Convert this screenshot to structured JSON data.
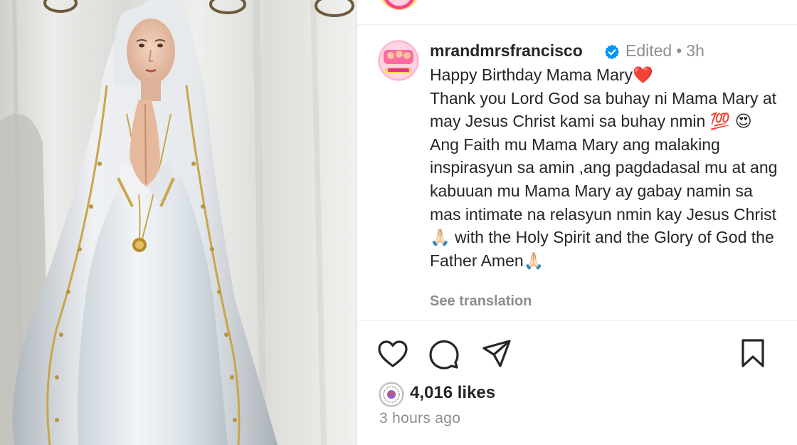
{
  "post": {
    "username": "mrandmrsfrancisco",
    "edited_label": "Edited",
    "separator": "•",
    "age": "3h",
    "caption": "Happy Birthday Mama Mary❤️\nThank you Lord God sa buhay ni Mama Mary at may  Jesus Christ kami sa buhay nmin 💯 😍 Ang Faith mu Mama Mary ang malaking inspirasyun sa amin ,ang pagdadasal mu at ang kabuuan mu Mama Mary ay gabay namin sa mas intimate na relasyun nmin kay Jesus Christ🙏🏻 with the Holy Spirit and the Glory of God the Father Amen🙏🏻",
    "see_translation": "See translation",
    "likes_text": "4,016 likes",
    "timestamp": "3 hours ago"
  },
  "icons": {
    "verified": "verified-badge-icon",
    "like": "heart-icon",
    "comment": "comment-bubble-icon",
    "share": "paper-plane-icon",
    "save": "bookmark-icon"
  },
  "colors": {
    "verified_blue": "#0095f6",
    "text_primary": "#262626",
    "text_secondary": "#8e8e8e"
  }
}
